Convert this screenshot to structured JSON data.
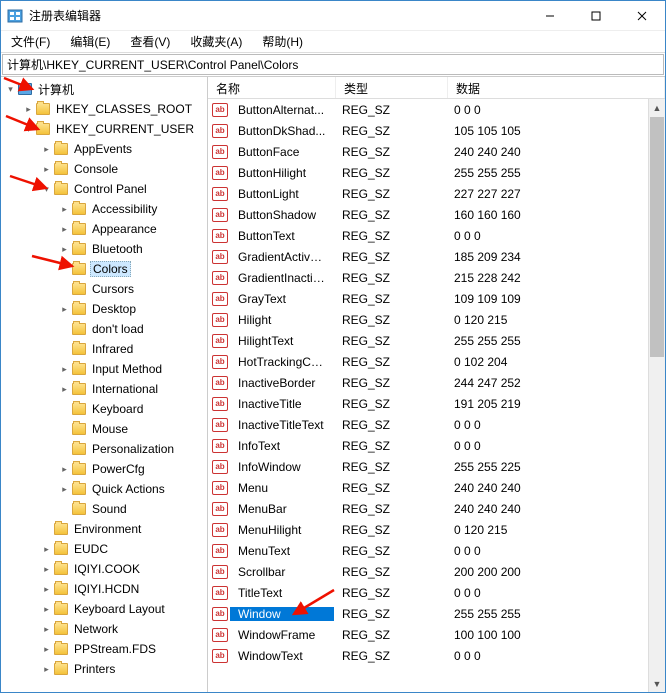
{
  "title": "注册表编辑器",
  "menubar": [
    "文件(F)",
    "编辑(E)",
    "查看(V)",
    "收藏夹(A)",
    "帮助(H)"
  ],
  "address": "计算机\\HKEY_CURRENT_USER\\Control Panel\\Colors",
  "tree": {
    "root": "计算机",
    "hives": [
      {
        "label": "HKEY_CLASSES_ROOT",
        "exp": "closed",
        "children": []
      },
      {
        "label": "HKEY_CURRENT_USER",
        "exp": "open",
        "children": [
          {
            "label": "AppEvents",
            "exp": "closed",
            "indent": 2
          },
          {
            "label": "Console",
            "exp": "closed",
            "indent": 2
          },
          {
            "label": "Control Panel",
            "exp": "open",
            "indent": 2,
            "children": [
              {
                "label": "Accessibility",
                "exp": "closed",
                "indent": 3
              },
              {
                "label": "Appearance",
                "exp": "closed",
                "indent": 3
              },
              {
                "label": "Bluetooth",
                "exp": "closed",
                "indent": 3
              },
              {
                "label": "Colors",
                "exp": "none",
                "indent": 3,
                "selected": true
              },
              {
                "label": "Cursors",
                "exp": "none",
                "indent": 3
              },
              {
                "label": "Desktop",
                "exp": "closed",
                "indent": 3
              },
              {
                "label": "don't load",
                "exp": "none",
                "indent": 3
              },
              {
                "label": "Infrared",
                "exp": "none",
                "indent": 3
              },
              {
                "label": "Input Method",
                "exp": "closed",
                "indent": 3
              },
              {
                "label": "International",
                "exp": "closed",
                "indent": 3
              },
              {
                "label": "Keyboard",
                "exp": "none",
                "indent": 3
              },
              {
                "label": "Mouse",
                "exp": "none",
                "indent": 3
              },
              {
                "label": "Personalization",
                "exp": "none",
                "indent": 3
              },
              {
                "label": "PowerCfg",
                "exp": "closed",
                "indent": 3
              },
              {
                "label": "Quick Actions",
                "exp": "closed",
                "indent": 3
              },
              {
                "label": "Sound",
                "exp": "none",
                "indent": 3
              }
            ]
          },
          {
            "label": "Environment",
            "exp": "none",
            "indent": 2
          },
          {
            "label": "EUDC",
            "exp": "closed",
            "indent": 2
          },
          {
            "label": "IQIYI.COOK",
            "exp": "closed",
            "indent": 2
          },
          {
            "label": "IQIYI.HCDN",
            "exp": "closed",
            "indent": 2
          },
          {
            "label": "Keyboard Layout",
            "exp": "closed",
            "indent": 2
          },
          {
            "label": "Network",
            "exp": "closed",
            "indent": 2
          },
          {
            "label": "PPStream.FDS",
            "exp": "closed",
            "indent": 2
          },
          {
            "label": "Printers",
            "exp": "closed",
            "indent": 2
          }
        ]
      }
    ]
  },
  "list": {
    "headers": {
      "name": "名称",
      "type": "类型",
      "data": "数据"
    },
    "icon_text": "ab",
    "rows": [
      {
        "name": "ButtonAlternat...",
        "type": "REG_SZ",
        "data": "0 0 0"
      },
      {
        "name": "ButtonDkShad...",
        "type": "REG_SZ",
        "data": "105 105 105"
      },
      {
        "name": "ButtonFace",
        "type": "REG_SZ",
        "data": "240 240 240"
      },
      {
        "name": "ButtonHilight",
        "type": "REG_SZ",
        "data": "255 255 255"
      },
      {
        "name": "ButtonLight",
        "type": "REG_SZ",
        "data": "227 227 227"
      },
      {
        "name": "ButtonShadow",
        "type": "REG_SZ",
        "data": "160 160 160"
      },
      {
        "name": "ButtonText",
        "type": "REG_SZ",
        "data": "0 0 0"
      },
      {
        "name": "GradientActive...",
        "type": "REG_SZ",
        "data": "185 209 234"
      },
      {
        "name": "GradientInactiv...",
        "type": "REG_SZ",
        "data": "215 228 242"
      },
      {
        "name": "GrayText",
        "type": "REG_SZ",
        "data": "109 109 109"
      },
      {
        "name": "Hilight",
        "type": "REG_SZ",
        "data": "0 120 215"
      },
      {
        "name": "HilightText",
        "type": "REG_SZ",
        "data": "255 255 255"
      },
      {
        "name": "HotTrackingCo...",
        "type": "REG_SZ",
        "data": "0 102 204"
      },
      {
        "name": "InactiveBorder",
        "type": "REG_SZ",
        "data": "244 247 252"
      },
      {
        "name": "InactiveTitle",
        "type": "REG_SZ",
        "data": "191 205 219"
      },
      {
        "name": "InactiveTitleText",
        "type": "REG_SZ",
        "data": "0 0 0"
      },
      {
        "name": "InfoText",
        "type": "REG_SZ",
        "data": "0 0 0"
      },
      {
        "name": "InfoWindow",
        "type": "REG_SZ",
        "data": "255 255 225"
      },
      {
        "name": "Menu",
        "type": "REG_SZ",
        "data": "240 240 240"
      },
      {
        "name": "MenuBar",
        "type": "REG_SZ",
        "data": "240 240 240"
      },
      {
        "name": "MenuHilight",
        "type": "REG_SZ",
        "data": "0 120 215"
      },
      {
        "name": "MenuText",
        "type": "REG_SZ",
        "data": "0 0 0"
      },
      {
        "name": "Scrollbar",
        "type": "REG_SZ",
        "data": "200 200 200"
      },
      {
        "name": "TitleText",
        "type": "REG_SZ",
        "data": "0 0 0"
      },
      {
        "name": "Window",
        "type": "REG_SZ",
        "data": "255 255 255",
        "selected": true
      },
      {
        "name": "WindowFrame",
        "type": "REG_SZ",
        "data": "100 100 100"
      },
      {
        "name": "WindowText",
        "type": "REG_SZ",
        "data": "0 0 0"
      }
    ]
  }
}
